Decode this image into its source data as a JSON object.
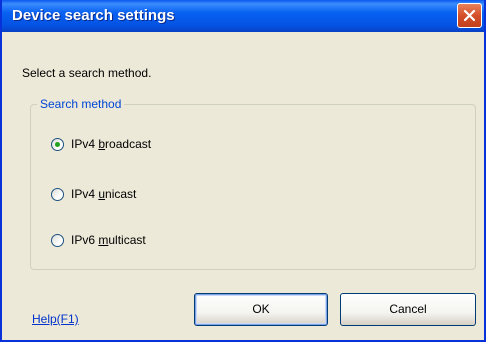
{
  "window": {
    "title": "Device search settings"
  },
  "dialog": {
    "prompt": "Select a search method.",
    "group_label": "Search method",
    "options": [
      {
        "pre": "IPv4 ",
        "accel": "b",
        "post": "roadcast",
        "selected": true
      },
      {
        "pre": "IPv4 ",
        "accel": "u",
        "post": "nicast",
        "selected": false
      },
      {
        "pre": "IPv6 ",
        "accel": "m",
        "post": "ulticast",
        "selected": false
      }
    ]
  },
  "buttons": {
    "ok": "OK",
    "cancel": "Cancel"
  },
  "help_link": "Help(F1)",
  "colors": {
    "titlebar": "#0761f2",
    "close_button": "#d4502a",
    "dialog_background": "#ece9d8",
    "group_label": "#0046d5",
    "radio_selected": "#21a121",
    "link": "#0033cc"
  }
}
